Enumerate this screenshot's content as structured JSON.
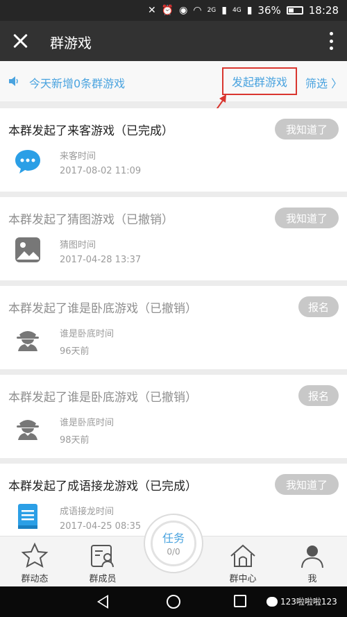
{
  "status_bar": {
    "battery_percent": "36%",
    "time": "18:28",
    "network_a": "2G",
    "network_b": "4G"
  },
  "header": {
    "title": "群游戏"
  },
  "notice": {
    "text": "今天新增0条群游戏",
    "launch_label": "发起群游戏",
    "filter_label": "筛选 〉"
  },
  "colors": {
    "accent_blue": "#4aa3df",
    "highlight_red": "#d9362f",
    "button_gray": "#c8c8c8"
  },
  "cards": [
    {
      "title": "本群发起了来客游戏（已完成）",
      "button": "我知道了",
      "label": "来客时间",
      "time": "2017-08-02 11:09",
      "icon": "chat-bubble-icon"
    },
    {
      "title": "本群发起了猜图游戏（已撤销）",
      "button": "我知道了",
      "label": "猜图时间",
      "time": "2017-04-28 13:37",
      "icon": "image-icon"
    },
    {
      "title": "本群发起了谁是卧底游戏（已撤销）",
      "button": "报名",
      "label": "谁是卧底时间",
      "time": "96天前",
      "icon": "spy-icon"
    },
    {
      "title": "本群发起了谁是卧底游戏（已撤销）",
      "button": "报名",
      "label": "谁是卧底时间",
      "time": "98天前",
      "icon": "spy-icon"
    },
    {
      "title": "本群发起了成语接龙游戏（已完成）",
      "button": "我知道了",
      "label": "成语接龙时间",
      "time": "2017-04-25 08:35",
      "icon": "book-icon"
    }
  ],
  "bottom_nav": {
    "items": [
      {
        "label": "群动态",
        "icon": "star-icon"
      },
      {
        "label": "群成员",
        "icon": "member-card-icon"
      },
      {
        "label": "群中心",
        "icon": "house-icon"
      },
      {
        "label": "我",
        "icon": "person-icon"
      }
    ],
    "task": {
      "label": "任务",
      "progress": "0/0"
    }
  },
  "watermark": {
    "text": "123啦啦啦123"
  }
}
